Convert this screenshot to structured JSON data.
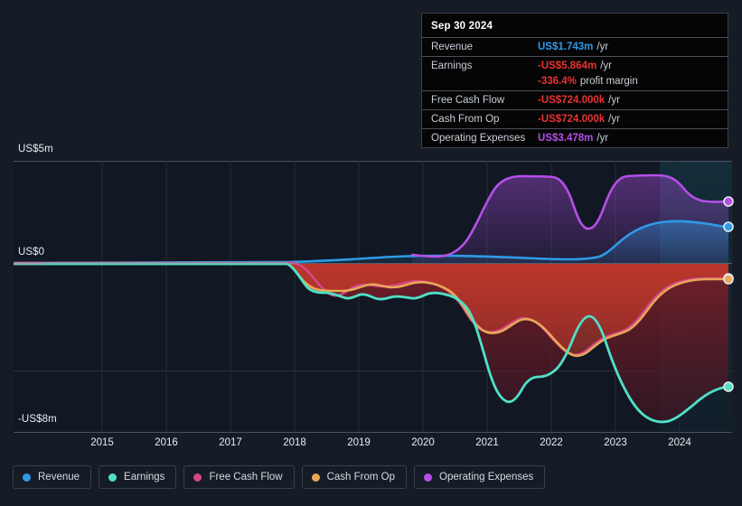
{
  "axes": {
    "y_labels": [
      "US$5m",
      "US$0",
      "-US$8m"
    ],
    "x_labels": [
      "2015",
      "2016",
      "2017",
      "2018",
      "2019",
      "2020",
      "2021",
      "2022",
      "2023",
      "2024"
    ]
  },
  "tooltip": {
    "title": "Sep 30 2024",
    "rows": [
      {
        "label": "Revenue",
        "value": "US$1.743m",
        "suffix": "/yr",
        "color": "#2e9be8"
      },
      {
        "label": "Earnings",
        "value": "-US$5.864m",
        "suffix": "/yr",
        "color": "#e83333"
      },
      {
        "label": "",
        "value": "-336.4%",
        "suffix": "profit margin",
        "color": "#e83333"
      },
      {
        "label": "Free Cash Flow",
        "value": "-US$724.000k",
        "suffix": "/yr",
        "color": "#e83333"
      },
      {
        "label": "Cash From Op",
        "value": "-US$724.000k",
        "suffix": "/yr",
        "color": "#e83333"
      },
      {
        "label": "Operating Expenses",
        "value": "US$3.478m",
        "suffix": "/yr",
        "color": "#b44fe8"
      }
    ]
  },
  "legend": [
    {
      "label": "Revenue",
      "color": "#2e9be8"
    },
    {
      "label": "Earnings",
      "color": "#4fe0c8"
    },
    {
      "label": "Free Cash Flow",
      "color": "#d6458a"
    },
    {
      "label": "Cash From Op",
      "color": "#e8a855"
    },
    {
      "label": "Operating Expenses",
      "color": "#b44fe8"
    }
  ],
  "chart_data": {
    "type": "line",
    "title": "",
    "xlabel": "",
    "ylabel": "",
    "ylim": [
      -8,
      5
    ],
    "xlim": [
      2014.4,
      2024.75
    ],
    "grid": true,
    "legend_position": "bottom",
    "y_ticks": [
      5,
      0,
      -8
    ],
    "x_ticks": [
      2015,
      2016,
      2017,
      2018,
      2019,
      2020,
      2021,
      2022,
      2023,
      2024
    ],
    "units": "US$ millions per year",
    "annotation": "Sep 30 2024 endpoint markers shown at right edge",
    "series": [
      {
        "name": "Revenue",
        "color": "#2e9be8",
        "x": [
          2014.4,
          2015,
          2016,
          2017,
          2018,
          2018.5,
          2019,
          2019.5,
          2020,
          2020.5,
          2021,
          2021.5,
          2022,
          2022.5,
          2023,
          2023.5,
          2024,
          2024.75
        ],
        "values": [
          0.0,
          0.0,
          0.0,
          0.0,
          0.02,
          0.05,
          0.08,
          0.1,
          0.12,
          0.12,
          0.1,
          0.08,
          0.08,
          0.3,
          1.1,
          1.65,
          1.82,
          1.743
        ]
      },
      {
        "name": "Earnings",
        "color": "#4fe0c8",
        "x": [
          2014.4,
          2015,
          2016,
          2017,
          2017.9,
          2018.1,
          2018.4,
          2018.7,
          2019,
          2019.2,
          2019.5,
          2019.8,
          2020,
          2020.3,
          2020.6,
          2021,
          2021.3,
          2021.5,
          2021.8,
          2022,
          2022.3,
          2022.6,
          2023,
          2023.4,
          2023.8,
          2024.1,
          2024.4,
          2024.75
        ],
        "values": [
          0.0,
          0.0,
          0.0,
          0.0,
          -0.05,
          -0.9,
          -1.3,
          -1.35,
          -1.25,
          -1.9,
          -1.6,
          -1.5,
          -1.55,
          -1.4,
          -2.4,
          -6.8,
          -7.1,
          -6.6,
          -6.45,
          -5.5,
          -2.45,
          -3.6,
          -5.6,
          -7.3,
          -7.8,
          -7.7,
          -6.7,
          -5.864
        ]
      },
      {
        "name": "Free Cash Flow",
        "color": "#d6458a",
        "x": [
          2014.4,
          2015,
          2016,
          2017,
          2018,
          2018.6,
          2019,
          2019.3,
          2019.6,
          2020,
          2020.4,
          2020.8,
          2021,
          2021.4,
          2021.7,
          2022,
          2022.4,
          2022.8,
          2023,
          2023.4,
          2024,
          2024.75
        ],
        "values": [
          0.0,
          0.0,
          0.0,
          0.0,
          0.0,
          -0.05,
          -1.6,
          -1.1,
          -0.9,
          -0.95,
          -0.7,
          -0.6,
          -1.25,
          -2.2,
          -2.35,
          -3.2,
          -3.9,
          -3.2,
          -2.8,
          -2.45,
          -0.85,
          -0.724
        ]
      },
      {
        "name": "Cash From Op",
        "color": "#e8a855",
        "x": [
          2014.4,
          2015,
          2016,
          2017,
          2017.9,
          2018.3,
          2018.7,
          2019,
          2019.3,
          2019.6,
          2020,
          2020.4,
          2020.8,
          2021,
          2021.4,
          2021.7,
          2022,
          2022.4,
          2022.8,
          2023,
          2023.4,
          2024,
          2024.75
        ],
        "values": [
          0.0,
          0.0,
          0.0,
          0.0,
          -0.02,
          -0.55,
          -1.05,
          -1.5,
          -1.05,
          -0.85,
          -0.9,
          -0.7,
          -0.6,
          -1.3,
          -2.25,
          -2.4,
          -3.25,
          -4.2,
          -3.55,
          -2.95,
          -2.45,
          -0.8,
          -0.724
        ]
      },
      {
        "name": "Operating Expenses",
        "color": "#b44fe8",
        "x": [
          2019.55,
          2019.8,
          2020.1,
          2020.4,
          2020.7,
          2021,
          2021.3,
          2021.6,
          2021.8,
          2022,
          2022.2,
          2022.45,
          2022.7,
          2023,
          2023.3,
          2023.9,
          2024.2,
          2024.5,
          2024.75
        ],
        "values": [
          0.35,
          0.32,
          0.3,
          0.35,
          0.6,
          2.0,
          3.6,
          4.05,
          4.1,
          4.1,
          3.0,
          1.6,
          2.3,
          4.2,
          4.35,
          4.35,
          3.9,
          3.55,
          3.478
        ]
      }
    ]
  }
}
